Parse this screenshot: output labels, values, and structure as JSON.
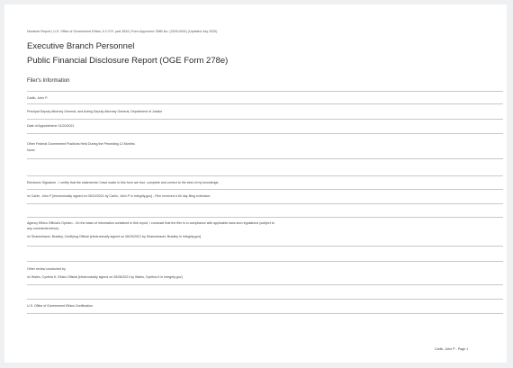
{
  "header": {
    "fineprint": "Nominee Report | U.S. Office of Government Ethics; 5 C.F.R. part 2634 | Form Approved: OMB No. (3209-0001) (Updated July 2020)",
    "title_line1": "Executive Branch Personnel",
    "title_line2": "Public Financial Disclosure Report (OGE Form 278e)"
  },
  "filer": {
    "section_title": "Filer's Information",
    "name": "Carlin, John P.",
    "position": "Principal Deputy Attorney General, and Acting Deputy Attorney General, Department of Justice",
    "appointment": "Date of Appointment: 01/20/2021",
    "other_positions_label": "Other Federal Government Positions Held During the Preceding 12 Months:",
    "other_positions_value": "None"
  },
  "signatures": {
    "electronic_signature": "Electronic Signature - I certify that the statements I have made in this form are true, complete and correct to the best of my knowledge.",
    "filer_signed": "/s/ Carlin, John P [electronically signed on 05/10/2021 by Carlin, John P in Integrity.gov] - Filer received a 60 day filing extension.",
    "agency_opinion_line1": "Agency Ethics Official's Opinion - On the basis of information contained in this report, I conclude that the filer is in compliance with applicable laws and regulations (subject to",
    "agency_opinion_line2": "any comments below).",
    "agency_signed": "/s/ Shaneshazer, Bradley, Certifying Official [electronically signed on 06/29/2021 by Shaneshazer, Bradley in Integrity.gov]",
    "other_review_label": "Other review conducted by",
    "other_review_signed": "/s/ Wales, Cynthia K, Ethics Official [electronically signed on 05/28/2021 by Wales, Cynthia K in Integrity.gov]",
    "oge_certification": "U.S. Office of Government Ethics Certification"
  },
  "footer": {
    "page_label": "Carlin, John P - Page 1"
  }
}
